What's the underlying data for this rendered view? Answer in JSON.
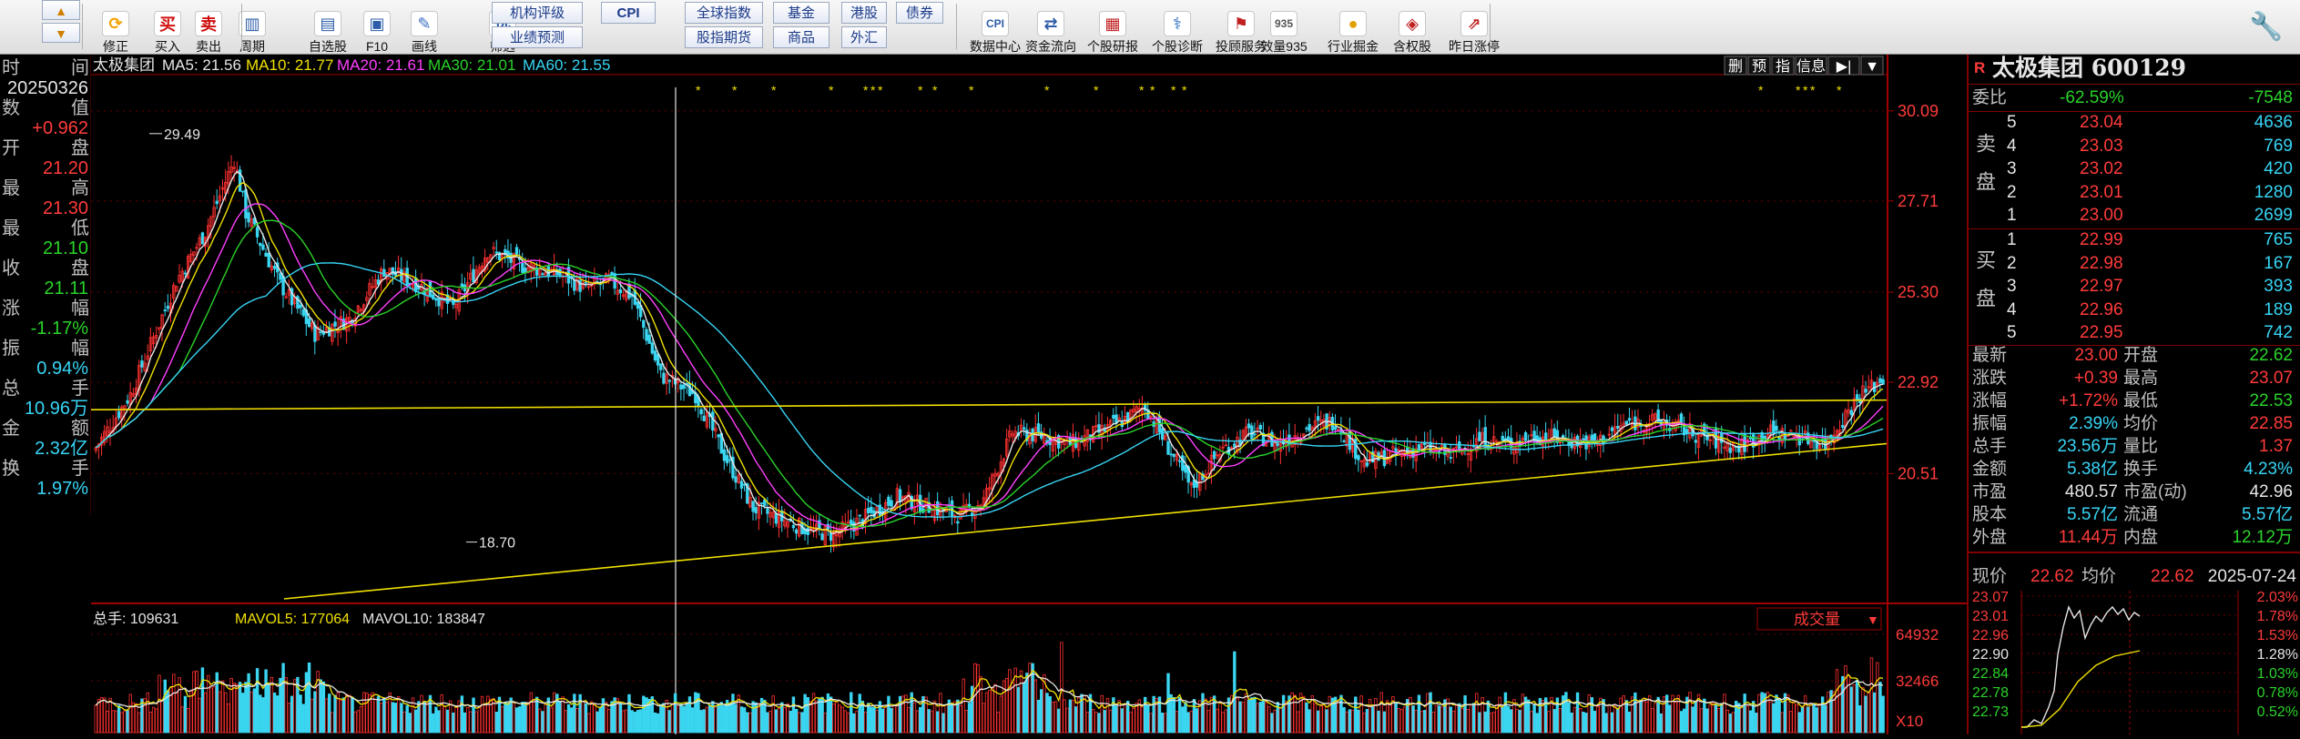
{
  "toolbar": {
    "buttons": [
      {
        "label": "修正",
        "icon": "refresh-icon"
      },
      {
        "label": "买入",
        "icon": "buy-icon"
      },
      {
        "label": "卖出",
        "icon": "sell-icon"
      },
      {
        "label": "周期",
        "icon": "period-icon"
      },
      {
        "label": "自选股",
        "icon": "watchlist-icon"
      },
      {
        "label": "F10",
        "icon": "f10-icon"
      },
      {
        "label": "画线",
        "icon": "draw-line-icon"
      },
      {
        "label": "筛选",
        "icon": "filter-icon"
      },
      {
        "label": "数据中心",
        "icon": "data-center-icon"
      },
      {
        "label": "资金流向",
        "icon": "fund-flow-icon"
      },
      {
        "label": "个股研报",
        "icon": "research-report-icon"
      },
      {
        "label": "个股诊断",
        "icon": "diagnosis-icon"
      },
      {
        "label": "投顾服务",
        "icon": "advisor-icon"
      },
      {
        "label": "效量935",
        "icon": "volume-icon"
      },
      {
        "label": "行业掘金",
        "icon": "industry-icon"
      },
      {
        "label": "含权股",
        "icon": "rights-icon"
      },
      {
        "label": "昨日涨停",
        "icon": "limit-up-icon"
      }
    ],
    "boxes": {
      "org_rating": "机构评级",
      "perf_forecast": "业绩预测",
      "cpi": "CPI",
      "global_index": "全球指数",
      "fund": "基金",
      "hk_stock": "港股",
      "bond": "债券",
      "index_futures": "股指期货",
      "commodity": "商品",
      "forex": "外汇"
    },
    "wrench_icon": "wrench-icon"
  },
  "left_panel": {
    "rows": [
      {
        "label": "时 间",
        "value": "20250326",
        "color": "#e6e6e6"
      },
      {
        "label": "数 值",
        "value": "+0.962",
        "color": "#ff3b3b"
      },
      {
        "label": "开 盘",
        "value": "21.20",
        "color": "#ff3b3b"
      },
      {
        "label": "最 高",
        "value": "21.30",
        "color": "#ff3b3b"
      },
      {
        "label": "最 低",
        "value": "21.10",
        "color": "#2ad32a"
      },
      {
        "label": "收 盘",
        "value": "21.11",
        "color": "#2ad32a"
      },
      {
        "label": "涨 幅",
        "value": "-1.17%",
        "color": "#2ad32a"
      },
      {
        "label": "振 幅",
        "value": "0.94%",
        "color": "#37d5f5"
      },
      {
        "label": "总 手",
        "value": "10.96万",
        "color": "#37d5f5"
      },
      {
        "label": "金 额",
        "value": "2.32亿",
        "color": "#37d5f5"
      },
      {
        "label": "换 手",
        "value": "1.97%",
        "color": "#37d5f5"
      }
    ]
  },
  "kline": {
    "stock_name": "太极集团",
    "ma_labels": [
      {
        "text": "MA5: 21.56",
        "color": "#e6e6e6"
      },
      {
        "text": "MA10: 21.77",
        "color": "#f0e000"
      },
      {
        "text": "MA20: 21.61",
        "color": "#ff40ff"
      },
      {
        "text": "MA30: 21.01",
        "color": "#2ad32a"
      },
      {
        "text": "MA60: 21.55",
        "color": "#37d5f5"
      }
    ],
    "right_buttons": [
      "删",
      "预",
      "指",
      "信息",
      "▶|",
      "▼"
    ],
    "y_ticks": [
      "30.09",
      "27.71",
      "25.30",
      "22.92",
      "20.51"
    ],
    "high_marker": "29.49",
    "low_marker": "18.70"
  },
  "volume": {
    "labels": [
      {
        "text": "总手: 109631",
        "color": "#e6e6e6"
      },
      {
        "text": "MAVOL5: 177064",
        "color": "#f0e000"
      },
      {
        "text": "MAVOL10: 183847",
        "color": "#e6e6e6"
      }
    ],
    "indicator": "成交量",
    "y_ticks": [
      "64932",
      "32466",
      "X10"
    ]
  },
  "quote": {
    "title": "太极集团 600129",
    "r_badge": "R",
    "weibi_label": "委比",
    "weibi_pct": "-62.59%",
    "weibi_val": "-7548",
    "sell_label": "卖盘",
    "buy_label": "买盘",
    "sell": [
      {
        "n": "5",
        "price": "23.04",
        "vol": "4636"
      },
      {
        "n": "4",
        "price": "23.03",
        "vol": "769"
      },
      {
        "n": "3",
        "price": "23.02",
        "vol": "420"
      },
      {
        "n": "2",
        "price": "23.01",
        "vol": "1280"
      },
      {
        "n": "1",
        "price": "23.00",
        "vol": "2699"
      }
    ],
    "buy": [
      {
        "n": "1",
        "price": "22.99",
        "vol": "765"
      },
      {
        "n": "2",
        "price": "22.98",
        "vol": "167"
      },
      {
        "n": "3",
        "price": "22.97",
        "vol": "393"
      },
      {
        "n": "4",
        "price": "22.96",
        "vol": "189"
      },
      {
        "n": "5",
        "price": "22.95",
        "vol": "742"
      }
    ],
    "stats": [
      {
        "l1": "最新",
        "v1": "23.00",
        "c1": "#ff3b3b",
        "l2": "开盘",
        "v2": "22.62",
        "c2": "#2ad32a"
      },
      {
        "l1": "涨跌",
        "v1": "+0.39",
        "c1": "#ff3b3b",
        "l2": "最高",
        "v2": "23.07",
        "c2": "#ff3b3b"
      },
      {
        "l1": "涨幅",
        "v1": "+1.72%",
        "c1": "#ff3b3b",
        "l2": "最低",
        "v2": "22.53",
        "c2": "#2ad32a"
      },
      {
        "l1": "振幅",
        "v1": "2.39%",
        "c1": "#37d5f5",
        "l2": "均价",
        "v2": "22.85",
        "c2": "#ff3b3b"
      },
      {
        "l1": "总手",
        "v1": "23.56万",
        "c1": "#37d5f5",
        "l2": "量比",
        "v2": "1.37",
        "c2": "#ff3b3b"
      },
      {
        "l1": "金额",
        "v1": "5.38亿",
        "c1": "#37d5f5",
        "l2": "换手",
        "v2": "4.23%",
        "c2": "#37d5f5"
      },
      {
        "l1": "市盈",
        "v1": "480.57",
        "c1": "#e6e6e6",
        "l2": "市盈(动)",
        "v2": "42.96",
        "c2": "#e6e6e6"
      },
      {
        "l1": "股本",
        "v1": "5.57亿",
        "c1": "#37d5f5",
        "l2": "流通",
        "v2": "5.57亿",
        "c2": "#37d5f5"
      },
      {
        "l1": "外盘",
        "v1": "11.44万",
        "c1": "#ff3b3b",
        "l2": "内盘",
        "v2": "12.12万",
        "c2": "#2ad32a"
      }
    ],
    "mini": {
      "now_label": "现价",
      "now_val": "22.62",
      "avg_label": "均价",
      "avg_val": "22.62",
      "date": "2025-07-24",
      "left_ticks": [
        "23.07",
        "23.01",
        "22.96",
        "22.90",
        "22.84",
        "22.78",
        "22.73"
      ],
      "right_ticks": [
        "2.03%",
        "1.78%",
        "1.53%",
        "1.28%",
        "1.03%",
        "0.78%",
        "0.52%"
      ]
    }
  }
}
